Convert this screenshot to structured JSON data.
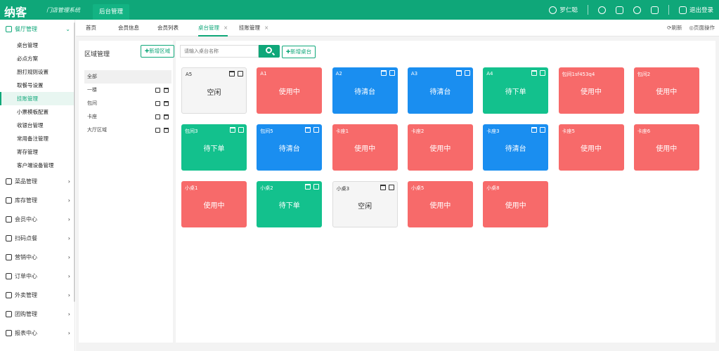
{
  "header": {
    "logo": "纳客",
    "slogan": "门店管理系统",
    "admin_tab": "后台管理",
    "user_name": "罗仁聪",
    "logout": "退出登录"
  },
  "sidebar": {
    "groups": [
      {
        "label": "餐厅管理",
        "icon": "restaurant-icon",
        "expanded": true,
        "items": [
          "桌台管理",
          "必点方案",
          "厨打规则设置",
          "取餐号设置",
          "挂账管理",
          "小票模板配置",
          "收银台管理",
          "常用备注管理",
          "寄存管理",
          "客户端设备管理"
        ],
        "active_item": "挂账管理"
      },
      {
        "label": "菜品管理",
        "icon": "dish-icon"
      },
      {
        "label": "库存管理",
        "icon": "stock-icon"
      },
      {
        "label": "会员中心",
        "icon": "member-icon"
      },
      {
        "label": "扫码点餐",
        "icon": "scan-icon"
      },
      {
        "label": "营销中心",
        "icon": "marketing-icon"
      },
      {
        "label": "订单中心",
        "icon": "order-icon"
      },
      {
        "label": "外卖管理",
        "icon": "takeout-icon"
      },
      {
        "label": "团购管理",
        "icon": "groupbuy-icon"
      },
      {
        "label": "报表中心",
        "icon": "report-icon"
      }
    ]
  },
  "tabs": {
    "items": [
      {
        "label": "首页",
        "closable": false
      },
      {
        "label": "会员信息",
        "closable": false
      },
      {
        "label": "会员列表",
        "closable": false
      },
      {
        "label": "桌台管理",
        "closable": true,
        "active": true
      },
      {
        "label": "挂账管理",
        "closable": true
      }
    ],
    "refresh": "刷新",
    "page_ops": "页面操作"
  },
  "area_panel": {
    "title": "区域管理",
    "add_button": "新增区域",
    "areas": [
      {
        "name": "全部",
        "active": true,
        "ops": false
      },
      {
        "name": "一楼",
        "ops": true
      },
      {
        "name": "包间",
        "ops": true
      },
      {
        "name": "卡座",
        "ops": true
      },
      {
        "name": "大厅区域",
        "ops": true
      }
    ]
  },
  "tables_panel": {
    "search_placeholder": "请输入桌台名称",
    "add_button": "新增桌台",
    "tables": [
      {
        "name": "A5",
        "status": "空闲",
        "color": "gray",
        "ops": true
      },
      {
        "name": "A1",
        "status": "使用中",
        "color": "red",
        "ops": false
      },
      {
        "name": "A2",
        "status": "待清台",
        "color": "blue",
        "ops": true
      },
      {
        "name": "A3",
        "status": "待清台",
        "color": "blue",
        "ops": true
      },
      {
        "name": "A4",
        "status": "待下单",
        "color": "green",
        "ops": true
      },
      {
        "name": "包间1sf453q4",
        "status": "使用中",
        "color": "red",
        "ops": false
      },
      {
        "name": "包间2",
        "status": "使用中",
        "color": "red",
        "ops": false
      },
      {
        "name": "包间3",
        "status": "待下单",
        "color": "green",
        "ops": true
      },
      {
        "name": "包间5",
        "status": "待清台",
        "color": "blue",
        "ops": true
      },
      {
        "name": "卡座1",
        "status": "使用中",
        "color": "red",
        "ops": false
      },
      {
        "name": "卡座2",
        "status": "使用中",
        "color": "red",
        "ops": false
      },
      {
        "name": "卡座3",
        "status": "待清台",
        "color": "blue",
        "ops": true
      },
      {
        "name": "卡座5",
        "status": "使用中",
        "color": "red",
        "ops": false
      },
      {
        "name": "卡座6",
        "status": "使用中",
        "color": "red",
        "ops": false
      },
      {
        "name": "小桌1",
        "status": "使用中",
        "color": "red",
        "ops": false
      },
      {
        "name": "小桌2",
        "status": "待下单",
        "color": "green",
        "ops": true
      },
      {
        "name": "小桌3",
        "status": "空闲",
        "color": "gray",
        "ops": true
      },
      {
        "name": "小桌5",
        "status": "使用中",
        "color": "red",
        "ops": false
      },
      {
        "name": "小桌8",
        "status": "使用中",
        "color": "red",
        "ops": false
      }
    ]
  },
  "colors": {
    "brand": "#0fa779",
    "red": "#f76a6a",
    "blue": "#1a8ef0",
    "green": "#13c18d",
    "gray": "#f5f5f5"
  }
}
